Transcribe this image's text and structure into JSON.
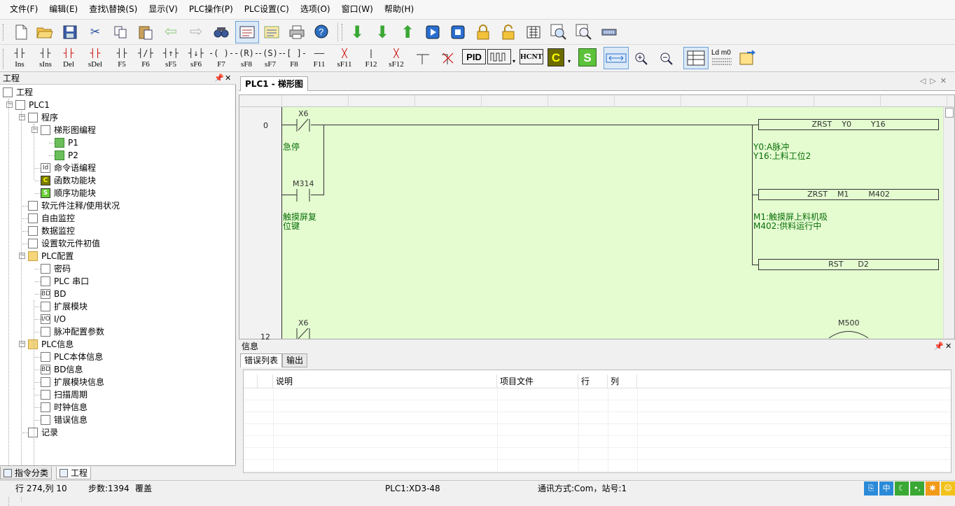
{
  "menu": [
    "文件(F)",
    "编辑(E)",
    "查找\\替换(S)",
    "显示(V)",
    "PLC操作(P)",
    "PLC设置(C)",
    "选项(O)",
    "窗口(W)",
    "帮助(H)"
  ],
  "toolbar1": {
    "icons": [
      "new-file-icon",
      "open-folder-icon",
      "save-icon",
      "cut-icon",
      "copy-icon",
      "paste-icon",
      "undo-icon",
      "redo-icon",
      "find-icon",
      "ladder-view-icon",
      "instruction-view-icon",
      "print-icon",
      "help-icon",
      "download-icon",
      "download-all-icon",
      "upload-icon",
      "run-icon",
      "stop-icon",
      "lock-icon",
      "unlock-icon",
      "monitor-icon",
      "zoom-monitor-icon",
      "search-monitor-icon",
      "comm-icon"
    ]
  },
  "toolbar2": {
    "buttons": [
      {
        "key": "Ins",
        "glyph": "┤├"
      },
      {
        "key": "sIns",
        "glyph": "┤├"
      },
      {
        "key": "Del",
        "glyph": "┤├"
      },
      {
        "key": "sDel",
        "glyph": "┤├"
      },
      {
        "key": "F5",
        "glyph": "┤├"
      },
      {
        "key": "F6",
        "glyph": "┤/├"
      },
      {
        "key": "sF5",
        "glyph": "┤↑├"
      },
      {
        "key": "sF6",
        "glyph": "┤↓├"
      },
      {
        "key": "F7",
        "glyph": "-( )-"
      },
      {
        "key": "sF8",
        "glyph": "-(R)-"
      },
      {
        "key": "sF7",
        "glyph": "-(S)-"
      },
      {
        "key": "F8",
        "glyph": "-[ ]-"
      },
      {
        "key": "F11",
        "glyph": "——"
      },
      {
        "key": "sF11",
        "glyph": "╳"
      },
      {
        "key": "F12",
        "glyph": "|"
      },
      {
        "key": "sF12",
        "glyph": "╳"
      }
    ],
    "extra_labels": {
      "pid": "PID",
      "hcnt": "HCNT",
      "c": "C",
      "s": "S",
      "ldm": "Ld m0"
    }
  },
  "project_panel": {
    "title": "工程",
    "tree": [
      {
        "label": "工程",
        "icon": "project-icon",
        "level": 0
      },
      {
        "label": "PLC1",
        "icon": "plc-icon",
        "level": 1
      },
      {
        "label": "程序",
        "icon": "doc-icon",
        "level": 2
      },
      {
        "label": "梯形图编程",
        "icon": "ladder-icon",
        "level": 3
      },
      {
        "label": "P1",
        "icon": "green-page-icon",
        "level": 4
      },
      {
        "label": "P2",
        "icon": "green-page-icon",
        "level": 4
      },
      {
        "label": "命令语编程",
        "icon": "command-icon",
        "level": 3
      },
      {
        "label": "函数功能块",
        "icon": "c-block-icon",
        "level": 3
      },
      {
        "label": "顺序功能块",
        "icon": "s-block-icon",
        "level": 3
      },
      {
        "label": "软元件注释/使用状况",
        "icon": "list-icon",
        "level": 2
      },
      {
        "label": "自由监控",
        "icon": "monitor-icon",
        "level": 2
      },
      {
        "label": "数据监控",
        "icon": "data-monitor-icon",
        "level": 2
      },
      {
        "label": "设置软元件初值",
        "icon": "grid-icon",
        "level": 2
      },
      {
        "label": "PLC配置",
        "icon": "folder-icon",
        "level": 2
      },
      {
        "label": "密码",
        "icon": "password-icon",
        "level": 3
      },
      {
        "label": "PLC 串口",
        "icon": "serial-icon",
        "level": 3
      },
      {
        "label": "BD",
        "icon": "bd-icon",
        "level": 3
      },
      {
        "label": "扩展模块",
        "icon": "expansion-icon",
        "level": 3
      },
      {
        "label": "I/O",
        "icon": "io-icon",
        "level": 3
      },
      {
        "label": "脉冲配置参数",
        "icon": "pulse-icon",
        "level": 3
      },
      {
        "label": "PLC信息",
        "icon": "folder-icon",
        "level": 2
      },
      {
        "label": "PLC本体信息",
        "icon": "info-icon",
        "level": 3
      },
      {
        "label": "BD信息",
        "icon": "bd-info-icon",
        "level": 3
      },
      {
        "label": "扩展模块信息",
        "icon": "expansion-info-icon",
        "level": 3
      },
      {
        "label": "扫描周期",
        "icon": "cycle-icon",
        "level": 3
      },
      {
        "label": "时钟信息",
        "icon": "clock-icon",
        "level": 3
      },
      {
        "label": "错误信息",
        "icon": "error-icon",
        "level": 3
      },
      {
        "label": "记录",
        "icon": "record-icon",
        "level": 2
      }
    ],
    "bottom_tabs": [
      "指令分类",
      "工程"
    ]
  },
  "editor": {
    "tab_title": "PLC1 - 梯形图",
    "rung_numbers": [
      "0",
      "12"
    ],
    "contacts": [
      {
        "name": "X6",
        "comment": "急停"
      },
      {
        "name": "M314",
        "comment": "触摸屏复\n位键"
      },
      {
        "name": "X6",
        "comment": ""
      }
    ],
    "instructions": [
      {
        "text": "ZRST    Y0        Y16",
        "comment": "Y0:A脉冲\nY16:上料工位2"
      },
      {
        "text": "ZRST    M1        M402",
        "comment": "M1:触摸屏上料机吸\nM402:供料运行中"
      },
      {
        "text": "RST      D2",
        "comment": ""
      }
    ],
    "coil_label": "M500"
  },
  "info_panel": {
    "title": "信息",
    "tabs": [
      "错误列表",
      "输出"
    ],
    "columns": [
      "",
      "说明",
      "项目文件",
      "行",
      "列"
    ]
  },
  "status": {
    "cursor": "行 274,列 10",
    "steps": "步数:1394",
    "mode": "覆盖",
    "plc": "PLC1:XD3-48",
    "comm": "通讯方式:Com，站号:1"
  }
}
